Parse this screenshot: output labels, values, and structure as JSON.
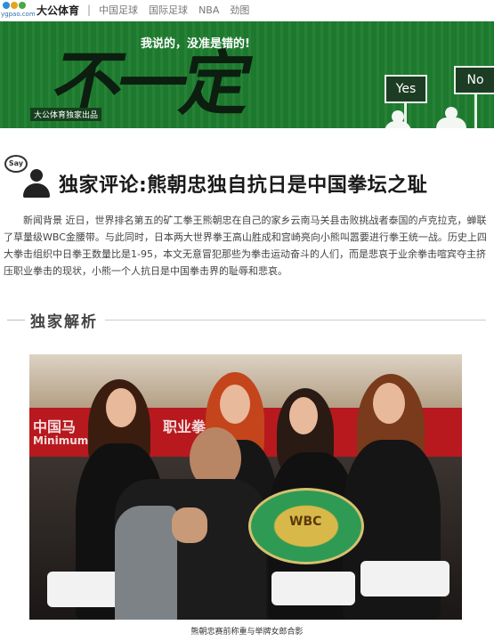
{
  "nav": {
    "logo_text": "ygpao.com",
    "brand": "大公体育",
    "separator": "|",
    "links": [
      "中国足球",
      "国际足球",
      "NBA",
      "劲图"
    ]
  },
  "banner": {
    "big_word": "不一定",
    "slogan": "我说的，没准是错的!",
    "credit": "大公体育独家出品",
    "sign_yes": "Yes",
    "sign_no": "No",
    "bg_color": "#1e7d2f"
  },
  "article": {
    "say_label": "Say",
    "headline": "独家评论:熊朝忠独自抗日是中国拳坛之耻",
    "summary": "新闻背景 近日，世界排名第五的矿工拳王熊朝忠在自己的家乡云南马关县击败挑战者泰国的卢克拉克，蝉联了草量级WBC金腰带。与此同时，日本两大世界拳王高山胜成和宫崎亮向小熊叫嚣要进行拳王统一战。历史上四大拳击组织中日拳王数量比是1-95，本文无意冒犯那些为拳击运动奋斗的人们，而是悲哀于业余拳击喧宾夺主挤压职业拳击的现状，小熊一个人抗日是中国拳击界的耻辱和悲哀。",
    "section_title": "独家解析",
    "photo_banner_text": [
      "中国马",
      "职业拳",
      "Minimum"
    ],
    "belt_text": "WBC",
    "caption": "熊朝忠赛前称重与举牌女郎合影"
  }
}
